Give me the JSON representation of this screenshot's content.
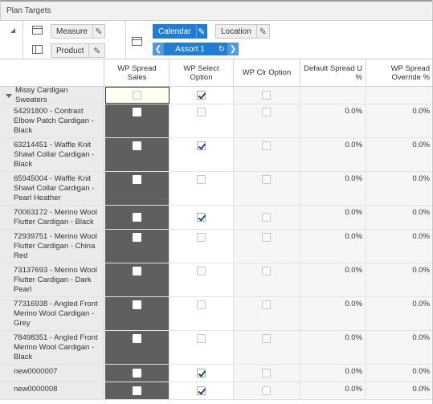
{
  "window": {
    "title": "Plan Targets"
  },
  "pivot": {
    "row_tiles": [
      {
        "label": "Measure"
      },
      {
        "label": "Product"
      }
    ],
    "col_tiles": [
      {
        "label": "Calendar"
      },
      {
        "label": "Location"
      }
    ],
    "assort": {
      "label": "Assort 1",
      "prev": "❮",
      "next": "❯",
      "rotate": "↻"
    },
    "edit_glyph": "✎"
  },
  "columns": [
    {
      "label": "WP Spread Sales"
    },
    {
      "label": "WP Select Option"
    },
    {
      "label": "WP Clr Option"
    },
    {
      "label": "Default Spread U %"
    },
    {
      "label": "WP Spread Override %"
    }
  ],
  "rows": [
    {
      "label": "Missy Cardigan Sweaters",
      "parent": true,
      "spread_sales": false,
      "select_option": true,
      "clr_option": false,
      "default_spread": "",
      "override": ""
    },
    {
      "label": "54291800 - Contrast Elbow Patch Cardigan - Black",
      "spread_sales": false,
      "select_option": false,
      "clr_option": false,
      "default_spread": "0.0%",
      "override": "0.0%"
    },
    {
      "label": "63214451 - Waffle Knit Shawl Collar Cardigan - Black",
      "spread_sales": false,
      "select_option": true,
      "clr_option": false,
      "default_spread": "0.0%",
      "override": "0.0%"
    },
    {
      "label": "65945004 - Waffle Knit Shawl Collar Cardigan - Pearl Heather",
      "spread_sales": false,
      "select_option": false,
      "clr_option": false,
      "default_spread": "0.0%",
      "override": "0.0%"
    },
    {
      "label": "70063172 - Merino Wool Flutter Cardigan - Black",
      "spread_sales": false,
      "select_option": true,
      "clr_option": false,
      "default_spread": "0.0%",
      "override": "0.0%"
    },
    {
      "label": "72939751 - Merino Wool Flutter Cardigan - China Red",
      "spread_sales": false,
      "select_option": false,
      "clr_option": false,
      "default_spread": "0.0%",
      "override": "0.0%"
    },
    {
      "label": "73137693 - Merino Wool Flutter Cardigan - Dark Pearl",
      "spread_sales": false,
      "select_option": false,
      "clr_option": false,
      "default_spread": "0.0%",
      "override": "0.0%"
    },
    {
      "label": "77316938 - Angled Front Merino Wool Cardigan - Grey",
      "spread_sales": false,
      "select_option": false,
      "clr_option": false,
      "default_spread": "0.0%",
      "override": "0.0%"
    },
    {
      "label": "78498351 - Angled Front Merino Wool Cardigan - Black",
      "spread_sales": false,
      "select_option": false,
      "clr_option": false,
      "default_spread": "0.0%",
      "override": "0.0%"
    },
    {
      "label": "new0000007",
      "spread_sales": false,
      "select_option": true,
      "clr_option": false,
      "default_spread": "0.0%",
      "override": "0.0%"
    },
    {
      "label": "new0000008",
      "spread_sales": false,
      "select_option": true,
      "clr_option": false,
      "default_spread": "0.0%",
      "override": "0.0%"
    }
  ],
  "colors": {
    "accent": "#1f7ed1",
    "dark_cell": "#5f5f5f",
    "row_header_bg": "#ebebeb"
  }
}
